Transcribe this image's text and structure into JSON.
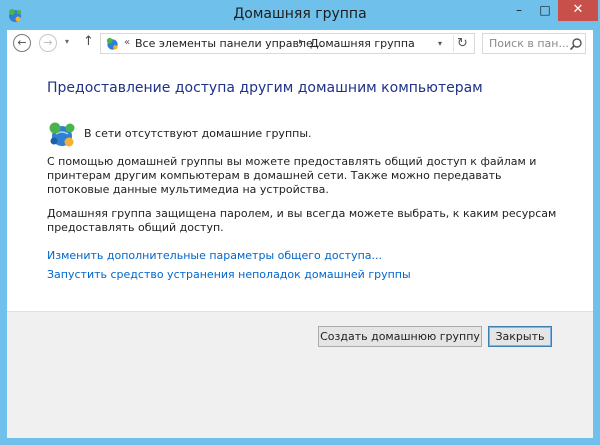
{
  "window": {
    "title": "Домашняя группа",
    "controls": {
      "minimize": "–",
      "maximize": "□",
      "close": "✕"
    }
  },
  "navigation": {
    "back_icon": "←",
    "forward_icon": "→",
    "recent_icon": "▾",
    "up_icon": "↑"
  },
  "address": {
    "chevrons": "«",
    "crumbs": [
      "Все элементы панели управле...",
      "Домашняя группа"
    ],
    "separator": "▸",
    "dropdown_icon": "▾",
    "refresh_icon": "↻"
  },
  "search": {
    "placeholder": "Поиск в пан..."
  },
  "content": {
    "heading": "Предоставление доступа другим домашним компьютерам",
    "status": "В сети отсутствуют домашние группы.",
    "paragraph1": "С помощью домашней группы вы можете предоставлять общий доступ к файлам и принтерам другим компьютерам в домашней сети. Также можно передавать потоковые данные мультимедиа на устройства.",
    "paragraph2": "Домашняя группа защищена паролем, и вы всегда можете выбрать, к каким ресурсам предоставлять общий доступ.",
    "links": [
      "Изменить дополнительные параметры общего доступа...",
      "Запустить средство устранения неполадок домашней группы"
    ]
  },
  "footer": {
    "create_button": "Создать домашнюю группу",
    "close_button": "Закрыть"
  },
  "colors": {
    "chrome": "#6fc1ec",
    "close_button": "#c7504a",
    "heading": "#1e3287",
    "link": "#0066cc",
    "footer_bg": "#f0f0f0"
  },
  "icons": [
    "homegroup-icon",
    "search-icon"
  ]
}
